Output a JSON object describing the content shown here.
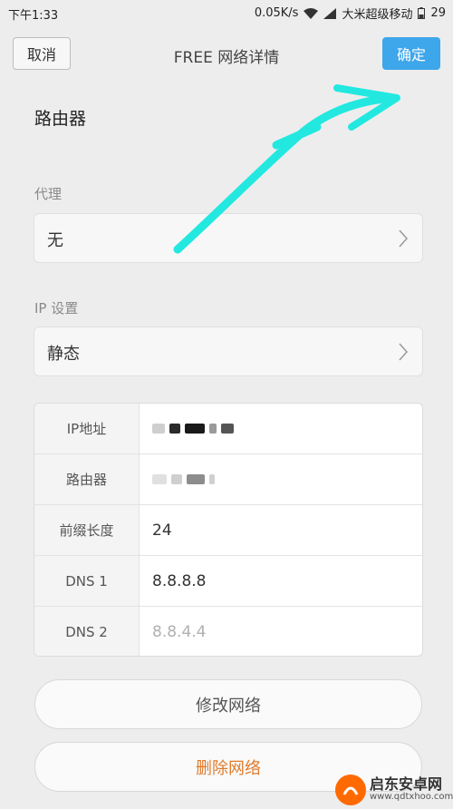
{
  "status_bar": {
    "time": "下午1:33",
    "speed": "0.05K/s",
    "carrier": "大米超级移动",
    "battery": "29"
  },
  "header": {
    "cancel_label": "取消",
    "title": "FREE  网络详情",
    "confirm_label": "确定"
  },
  "section": {
    "title": "路由器"
  },
  "proxy": {
    "label": "代理",
    "value": "无"
  },
  "ip_settings": {
    "label": "IP 设置",
    "value": "静态"
  },
  "details": [
    {
      "key": "IP地址",
      "value": ""
    },
    {
      "key": "路由器",
      "value": ""
    },
    {
      "key": "前缀长度",
      "value": "24"
    },
    {
      "key": "DNS 1",
      "value": "8.8.8.8"
    },
    {
      "key": "DNS 2",
      "value": "8.8.4.4"
    }
  ],
  "actions": {
    "edit_label": "修改网络",
    "delete_label": "删除网络"
  },
  "watermark": {
    "name": "启东安卓网",
    "url": "www.qdtxhoo.com"
  },
  "colors": {
    "accent": "#3ea6ea",
    "danger": "#e07a2a",
    "annotation": "#22e8e0"
  }
}
